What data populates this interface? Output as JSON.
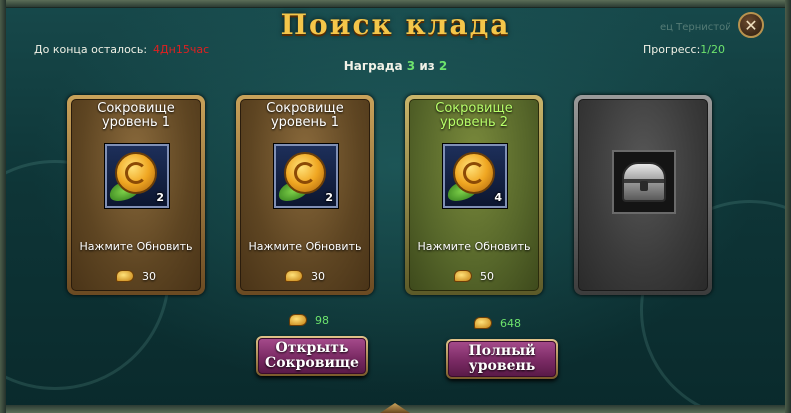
{
  "header": {
    "title": "Поиск клада",
    "faded_text": "ец Тернистой Дол",
    "timer_label": "До конца осталось:",
    "timer_value": "4Дн15час",
    "progress_label": "Прогресс:",
    "progress_value": "1/20",
    "reward_label": "Награда",
    "reward_current": "3",
    "reward_sep": "из",
    "reward_total": "2"
  },
  "cards": [
    {
      "title_line1": "Сокровище",
      "title_line2": "уровень 1",
      "quantity": "2",
      "hint": "Нажмите Обновить",
      "cost": "30",
      "style": "gold"
    },
    {
      "title_line1": "Сокровище",
      "title_line2": "уровень 1",
      "quantity": "2",
      "hint": "Нажмите Обновить",
      "cost": "30",
      "style": "gold"
    },
    {
      "title_line1": "Сокровище",
      "title_line2": "уровень 2",
      "quantity": "4",
      "hint": "Нажмите Обновить",
      "cost": "50",
      "style": "green"
    },
    {
      "style": "locked"
    }
  ],
  "actions": {
    "open_cost": "98",
    "open_label": "Открыть\nСокровище",
    "full_cost": "648",
    "full_label": "Полный\nуровень"
  },
  "colors": {
    "title": "#f4c64a",
    "timer_value": "#e02020",
    "accent_green": "#6de36d",
    "button_face": "#7a2a64"
  },
  "icons": {
    "close": "close-icon",
    "gold": "gold-ingot-icon",
    "treasure": "gold-coin-icon",
    "chest": "silver-chest-icon"
  }
}
